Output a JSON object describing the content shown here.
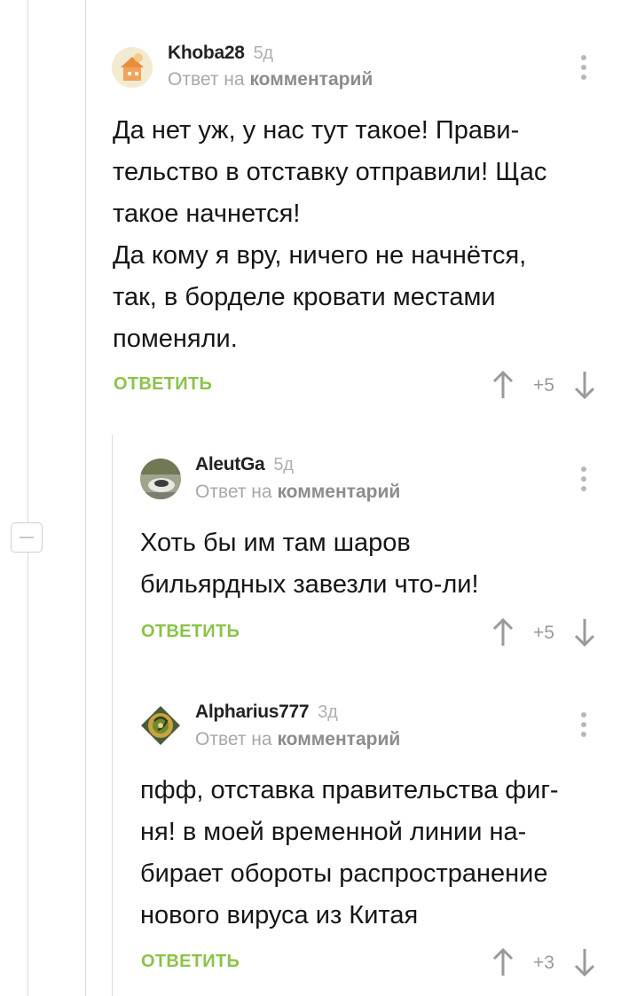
{
  "comments": [
    {
      "author": "Khoba28",
      "age": "5д",
      "reply_prefix": "Ответ на",
      "reply_target": "комментарий",
      "body": [
        "Да нет уж, у нас тут такое! Прави-",
        "тельство в отставку отправили! Щас",
        "такое начнется!",
        "Да кому я вру, ничего не начнётся,",
        "так, в борделе кровати местами",
        "поменяли."
      ],
      "reply_label": "ОТВЕТИТЬ",
      "rating": "+5"
    },
    {
      "author": "AleutGa",
      "age": "5д",
      "reply_prefix": "Ответ на",
      "reply_target": "комментарий",
      "body": [
        "Хоть бы им там шаров",
        "бильярдных завезли что-ли!"
      ],
      "reply_label": "ОТВЕТИТЬ",
      "rating": "+5"
    },
    {
      "author": "Alpharius777",
      "age": "3д",
      "reply_prefix": "Ответ на",
      "reply_target": "комментарий",
      "body": [
        "пфф, отставка правительства фиг-",
        "ня! в моей временной линии на-",
        "бирает обороты распространение",
        "нового вируса из Китая"
      ],
      "reply_label": "ОТВЕТИТЬ",
      "rating": "+3"
    }
  ],
  "colors": {
    "reply_green": "#8bc34a",
    "muted": "#a8a8a8",
    "line": "#dcdcdc"
  },
  "icons": [
    "kebab-menu-icon",
    "arrow-up-icon",
    "arrow-down-icon",
    "collapse-minus-icon"
  ]
}
